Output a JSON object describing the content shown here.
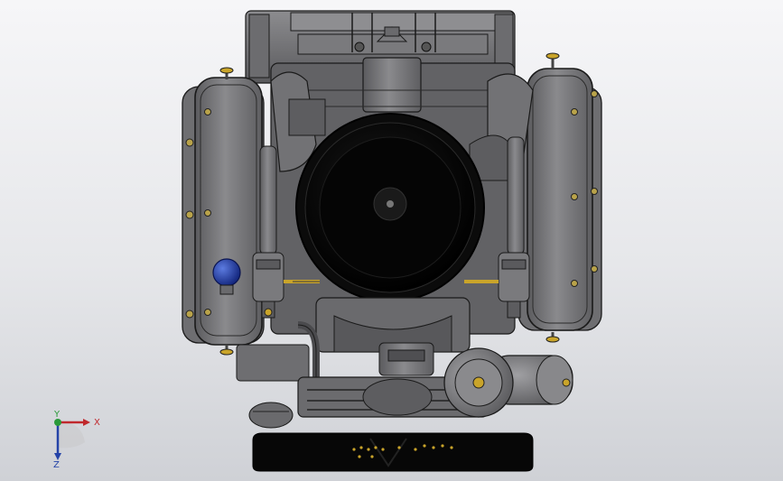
{
  "viewport": {
    "model": "engine-assembly-front-view"
  },
  "triad": {
    "x_label": "X",
    "y_label": "Y",
    "z_label": "Z",
    "x_color": "#c0282c",
    "y_color": "#2a9a3a",
    "z_color": "#2443a8"
  },
  "colors": {
    "background_top": "#f6f6f8",
    "background_bottom": "#cfd1d6",
    "metal_gray": "#7b7b7d",
    "metal_dark": "#4f4f52",
    "edge_black": "#1a1a1a",
    "fan_black": "#050505",
    "plug_blue": "#1f3fa8",
    "brass": "#c9a42a"
  }
}
